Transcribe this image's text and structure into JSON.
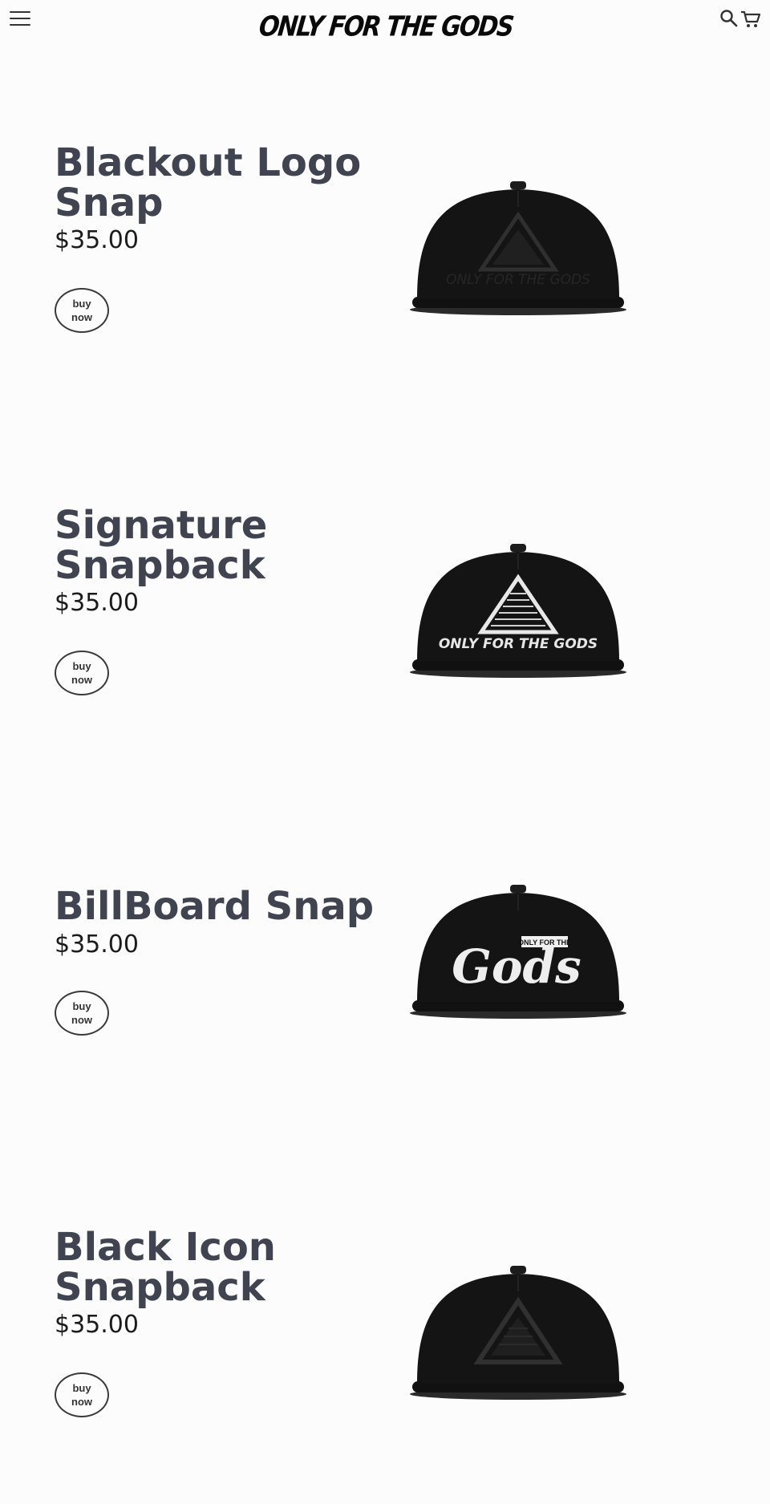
{
  "header": {
    "brand": "ONLY FOR THE GODS",
    "menu_icon": "hamburger-menu-icon",
    "search_icon": "search-icon",
    "cart_icon": "cart-icon"
  },
  "products": [
    {
      "title": "Blackout Logo Snap",
      "price": "$35.00",
      "button": "buy now",
      "image": "black cap with dark pyramid logo and wordmark"
    },
    {
      "title": "Signature Snapback",
      "price": "$35.00",
      "button": "buy now",
      "image": "black cap with white pyramid logo and wordmark"
    },
    {
      "title": "BillBoard Snap",
      "price": "$35.00",
      "button": "buy now",
      "image": "black cap with white script Gods logo"
    },
    {
      "title": "Black Icon Snapback",
      "price": "$35.00",
      "button": "buy now",
      "image": "black cap with dark pyramid icon"
    }
  ],
  "cap_graphics": {
    "signature_wordmark": "ONLY FOR THE GODS",
    "billboard_small": "ONLY FOR THE",
    "billboard_script": "Gods"
  },
  "colors": {
    "title": "#3f4450",
    "price": "#1c1c1c",
    "cap": "#111111",
    "background": "#fdfcfd"
  }
}
